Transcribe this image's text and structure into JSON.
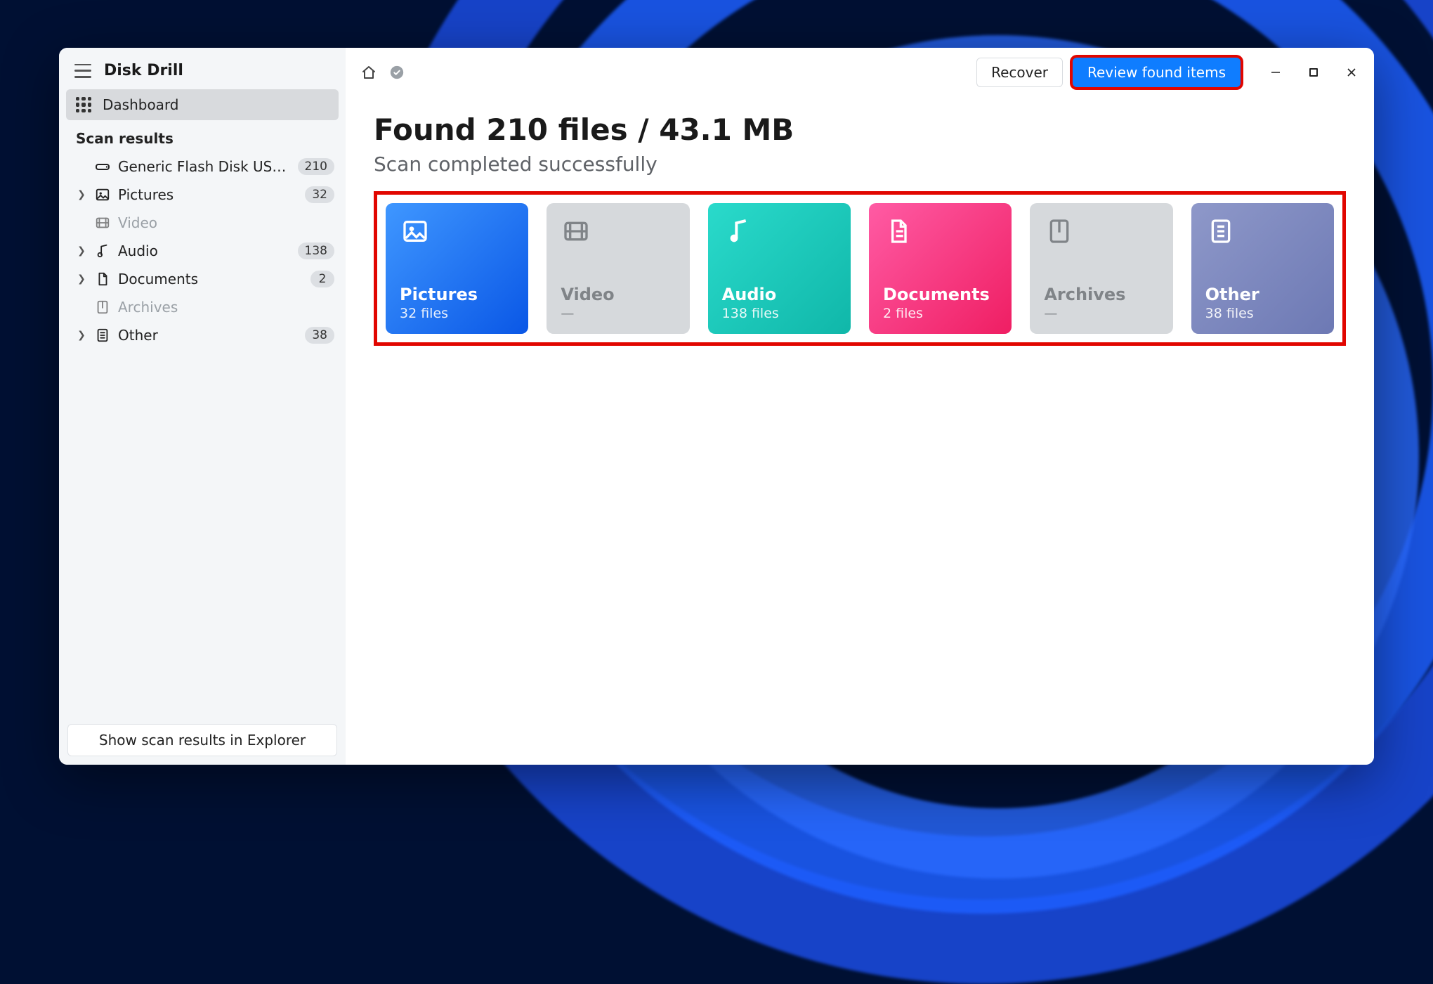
{
  "app": {
    "title": "Disk Drill"
  },
  "sidebar": {
    "dashboard_label": "Dashboard",
    "section_label": "Scan results",
    "device": {
      "label": "Generic Flash Disk USB…",
      "count": "210"
    },
    "items": [
      {
        "id": "pictures",
        "label": "Pictures",
        "count": "32",
        "expandable": true,
        "muted": false
      },
      {
        "id": "video",
        "label": "Video",
        "count": "",
        "expandable": false,
        "muted": true
      },
      {
        "id": "audio",
        "label": "Audio",
        "count": "138",
        "expandable": true,
        "muted": false
      },
      {
        "id": "documents",
        "label": "Documents",
        "count": "2",
        "expandable": true,
        "muted": false
      },
      {
        "id": "archives",
        "label": "Archives",
        "count": "",
        "expandable": false,
        "muted": true
      },
      {
        "id": "other",
        "label": "Other",
        "count": "38",
        "expandable": true,
        "muted": false
      }
    ],
    "footer_button": "Show scan results in Explorer"
  },
  "toolbar": {
    "recover_label": "Recover",
    "review_label": "Review found items"
  },
  "main": {
    "headline": "Found 210 files / 43.1 MB",
    "subhead": "Scan completed successfully"
  },
  "cards": [
    {
      "id": "pictures",
      "title": "Pictures",
      "sub": "32 files",
      "style": "pictures"
    },
    {
      "id": "video",
      "title": "Video",
      "sub": "—",
      "style": "empty"
    },
    {
      "id": "audio",
      "title": "Audio",
      "sub": "138 files",
      "style": "audio"
    },
    {
      "id": "documents",
      "title": "Documents",
      "sub": "2 files",
      "style": "docs"
    },
    {
      "id": "archives",
      "title": "Archives",
      "sub": "—",
      "style": "empty"
    },
    {
      "id": "other",
      "title": "Other",
      "sub": "38 files",
      "style": "other"
    }
  ]
}
